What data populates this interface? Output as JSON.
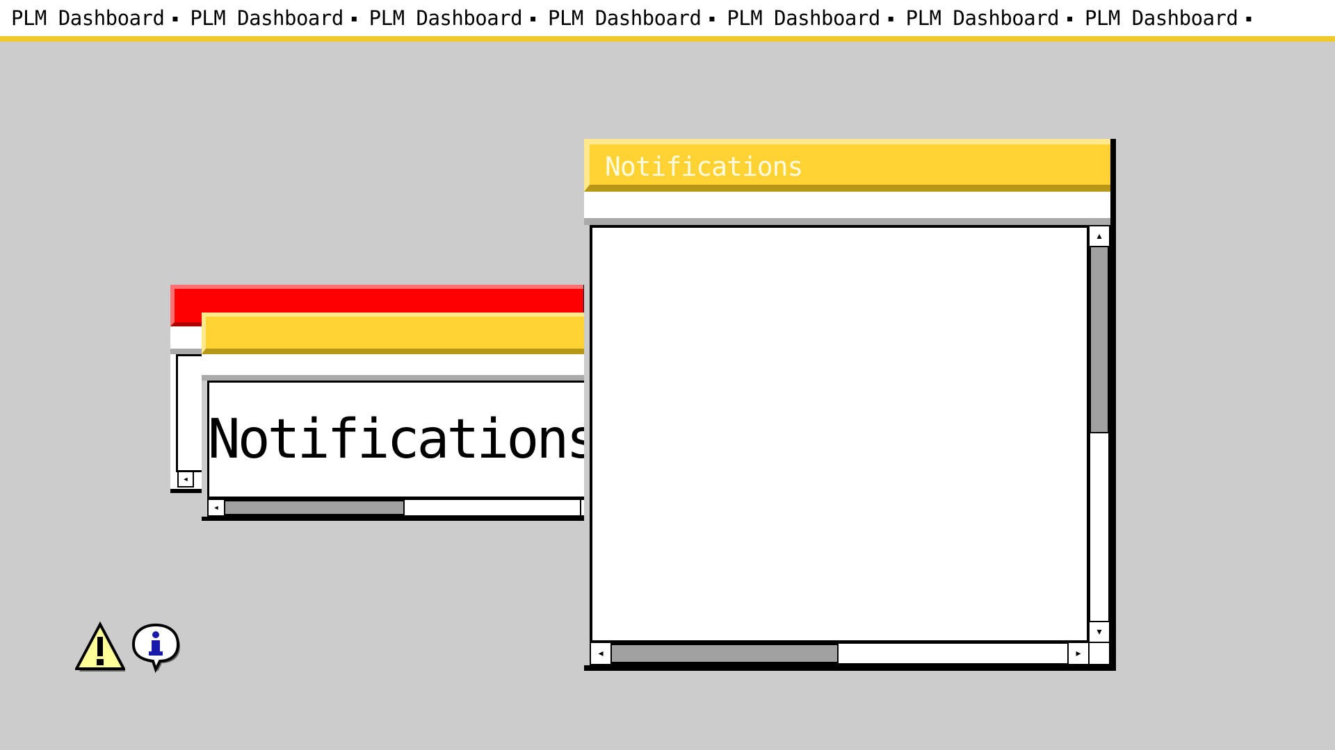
{
  "ticker": {
    "items": [
      "PLM Dashboard",
      "PLM Dashboard",
      "PLM Dashboard",
      "PLM Dashboard",
      "PLM Dashboard",
      "PLM Dashboard",
      "PLM Dashboard"
    ],
    "separator": "▪"
  },
  "windows": {
    "main": {
      "title": "Notifications"
    },
    "small": {
      "body_text": "Notifications"
    },
    "back": {
      "title": ""
    }
  },
  "colors": {
    "accent_yellow": "#ffd233",
    "alert_red": "#ff0000",
    "desktop_gray": "#cccccc"
  },
  "icons": [
    "warning-icon",
    "info-icon"
  ]
}
